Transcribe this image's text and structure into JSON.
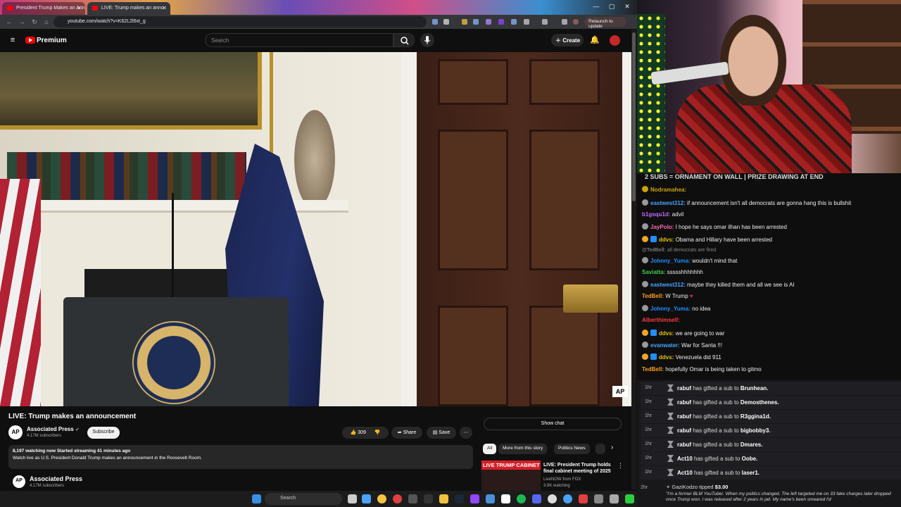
{
  "browser": {
    "tabs": [
      {
        "label": "President Trump Makes an Ann"
      },
      {
        "label": "LIVE: Trump makes an anno"
      }
    ],
    "url": "youtube.com/watch?v=K62L2l6xt_g",
    "relaunch_label": "Relaunch to update"
  },
  "header": {
    "logo_text": "Premium",
    "search_placeholder": "Search",
    "create_label": "Create"
  },
  "video": {
    "title": "LIVE: Trump makes an announcement",
    "watermark": "AP"
  },
  "channel": {
    "avatar_text": "AP",
    "name": "Associated Press",
    "subscribers": "4.17M subscribers",
    "subscribe_label": "Subscribe"
  },
  "actions": {
    "like_count": "309",
    "share_label": "Share",
    "save_label": "Save"
  },
  "description": {
    "stats": "8,197 watching now  Started streaming 41 minutes ago",
    "text": "Watch live as U.S. President Donald Trump makes an announcement in the Roosevelt Room."
  },
  "channel_card": {
    "avatar_text": "AP",
    "name": "Associated Press",
    "subscribers": "4.17M subscribers"
  },
  "sidebar": {
    "show_chat_label": "Show chat",
    "chips": [
      "All",
      "More from this story",
      "Politics News"
    ],
    "recommendation": {
      "thumb_text": "LIVE TRUMP CABINET",
      "title": "LIVE: President Trump holds final cabinet meeting of 2025",
      "channel": "LiveNOW from FOX",
      "views": "3.8K watching"
    }
  },
  "stream": {
    "banner": "2 SUBS = ORNAMENT ON WALL | PRIZE DRAWING AT END"
  },
  "chat": {
    "messages": [
      {
        "user": "Nodramahea:",
        "text": "",
        "color": "#c9a500"
      },
      {
        "user": "eastwest312:",
        "text": "if announcement isn't all democrats are gonna hang this is bullshit",
        "color": "#4aa3ff"
      },
      {
        "user": "b1gsqu1d:",
        "text": "advil",
        "color": "#c06bff"
      },
      {
        "user": "JayPolo:",
        "text": "I hope he says omar ilhan has been arrested",
        "color": "#ff69b4"
      },
      {
        "user": "ddvs:",
        "text": "Obama and Hillary have been arrested",
        "color": "#e5c100"
      },
      {
        "user": "@TedBell:",
        "text": "all democrats are fired",
        "color": "#777777"
      },
      {
        "user": "Johnny_Yuma:",
        "text": "wouldn't mind that",
        "color": "#1e90ff"
      },
      {
        "user": "Saviatta:",
        "text": "ssssshhhhhhh",
        "color": "#3ad14a"
      },
      {
        "user": "eastwest312:",
        "text": "maybe they killed them and all we see is AI",
        "color": "#4aa3ff"
      },
      {
        "user": "TedBell:",
        "text": "W Trump",
        "color": "#ff9f1a"
      },
      {
        "user": "Johnny_Yuma:",
        "text": "no idea",
        "color": "#1e90ff"
      },
      {
        "user": "Alberthimself:",
        "text": "",
        "color": "#ff3b3b"
      },
      {
        "user": "ddvs:",
        "text": "we are going to war",
        "color": "#e5c100"
      },
      {
        "user": "evanwater:",
        "text": "War for Santa !!!",
        "color": "#4aa3ff"
      },
      {
        "user": "ddvs:",
        "text": "Venezuela did 911",
        "color": "#e5c100"
      },
      {
        "user": "TedBell:",
        "text": "hopefully Omar is being taken to gitmo",
        "color": "#ff9f1a"
      }
    ],
    "gifts": [
      {
        "time": "1hr",
        "gifter": "rabuf",
        "action": "has gifted a sub to",
        "recipient": "Brunhean."
      },
      {
        "time": "1hr",
        "gifter": "rabuf",
        "action": "has gifted a sub to",
        "recipient": "Demosthenes."
      },
      {
        "time": "1hr",
        "gifter": "rabuf",
        "action": "has gifted a sub to",
        "recipient": "R3ggina1d."
      },
      {
        "time": "1hr",
        "gifter": "rabuf",
        "action": "has gifted a sub to",
        "recipient": "bigbobby3."
      },
      {
        "time": "1hr",
        "gifter": "rabuf",
        "action": "has gifted a sub to",
        "recipient": "Dmares."
      },
      {
        "time": "1hr",
        "gifter": "Act10",
        "action": "has gifted a sub to",
        "recipient": "Oobe."
      },
      {
        "time": "1hr",
        "gifter": "Act10",
        "action": "has gifted a sub to",
        "recipient": "laser1."
      }
    ],
    "tip": {
      "time": "2hr",
      "user": "GaziKodzo",
      "action": "tipped",
      "amount": "$3.00",
      "message": "\"I'm a former BLM YouTuber. When my politics changed, The left targeted me on 33 fake charges later dropped once Trump won. I was released after 2 years in jail. My name's been smeared I'd"
    }
  },
  "taskbar": {
    "search_label": "Search"
  }
}
